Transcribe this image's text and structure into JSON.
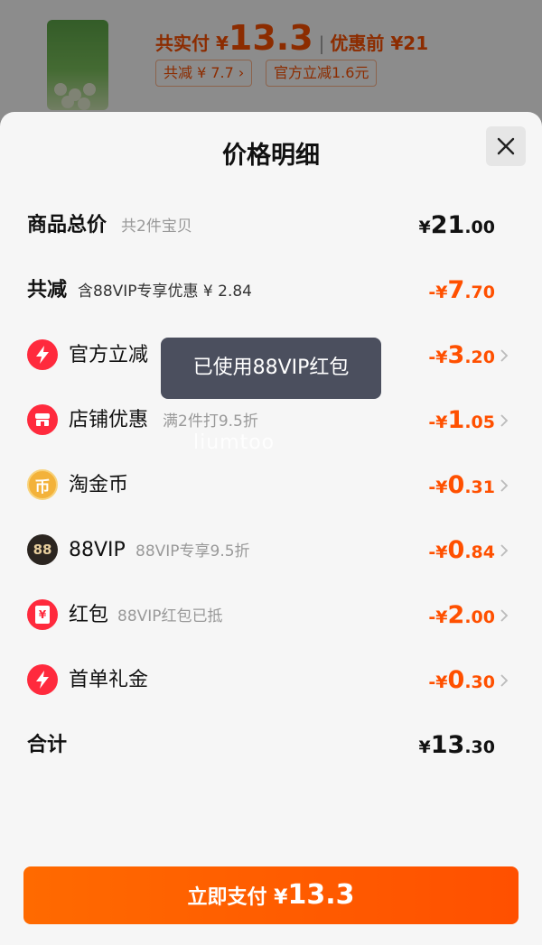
{
  "background": {
    "total_label": "共实付 ¥",
    "total_value": "13.3",
    "before_label": "优惠前 ¥21",
    "chip_reduce": "共减 ¥ 7.7",
    "chip_official": "官方立减1.6元"
  },
  "sheet": {
    "title": "价格明细",
    "rows": [
      {
        "name": "商品总价",
        "sub": "共2件宝贝",
        "currency": "¥",
        "int": "21",
        "dec": ".00"
      },
      {
        "name": "共减",
        "sub": "含88VIP专享优惠 ¥ 2.84",
        "currency": "-¥",
        "int": "7",
        "dec": ".70"
      },
      {
        "name": "官方立减",
        "sub": "",
        "currency": "-¥",
        "int": "3",
        "dec": ".20",
        "icon": "lightning-icon"
      },
      {
        "name": "店铺优惠",
        "sub": "满2件打9.5折",
        "currency": "-¥",
        "int": "1",
        "dec": ".05",
        "icon": "shop-icon"
      },
      {
        "name": "淘金币",
        "sub": "",
        "currency": "-¥",
        "int": "0",
        "dec": ".31",
        "icon": "coin-icon",
        "icon_text": "币"
      },
      {
        "name": "88VIP",
        "sub": "88VIP专享9.5折",
        "currency": "-¥",
        "int": "0",
        "dec": ".84",
        "icon": "vip88-icon",
        "icon_text": "88"
      },
      {
        "name": "红包",
        "sub": "88VIP红包已抵",
        "currency": "-¥",
        "int": "2",
        "dec": ".00",
        "icon": "red-packet-icon",
        "icon_text": "¥"
      },
      {
        "name": "首单礼金",
        "sub": "",
        "currency": "-¥",
        "int": "0",
        "dec": ".30",
        "icon": "lightning-icon"
      },
      {
        "name": "合计",
        "sub": "",
        "currency": "¥",
        "int": "13",
        "dec": ".30"
      }
    ],
    "toast": "已使用88VIP红包",
    "watermark": "liumtoo",
    "pay_button": {
      "label": "立即支付 ¥",
      "amount": "13.3"
    }
  },
  "colors": {
    "accent": "#ff5000",
    "toast_bg": "#414655",
    "icon_red": "#ff2a3d",
    "icon_gold": "#f3b23a",
    "icon_dark": "#2b2520"
  }
}
